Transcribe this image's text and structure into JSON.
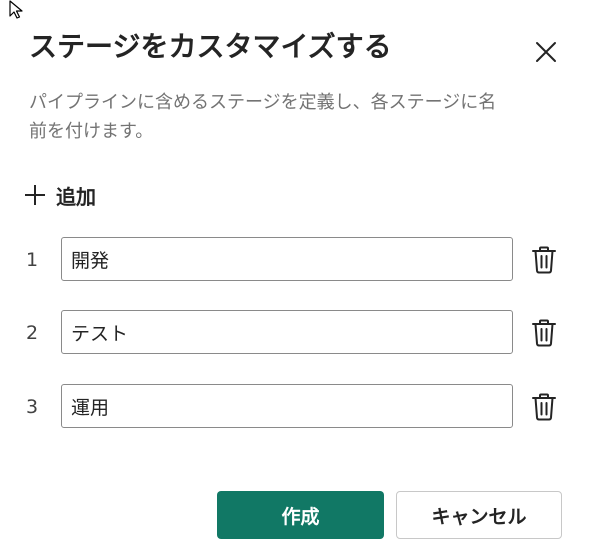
{
  "dialog": {
    "title": "ステージをカスタマイズする",
    "description": "パイプラインに含めるステージを定義し、各ステージに名前を付けます。",
    "close_icon": "close-icon",
    "add_label": "追加",
    "add_icon": "plus-icon",
    "stages": [
      {
        "number": "1",
        "name": "開発"
      },
      {
        "number": "2",
        "name": "テスト"
      },
      {
        "number": "3",
        "name": "運用"
      }
    ],
    "delete_icon": "trash-icon",
    "create_label": "作成",
    "cancel_label": "キャンセル",
    "colors": {
      "primary": "#117865",
      "text": "#242424",
      "muted": "#737373"
    }
  }
}
